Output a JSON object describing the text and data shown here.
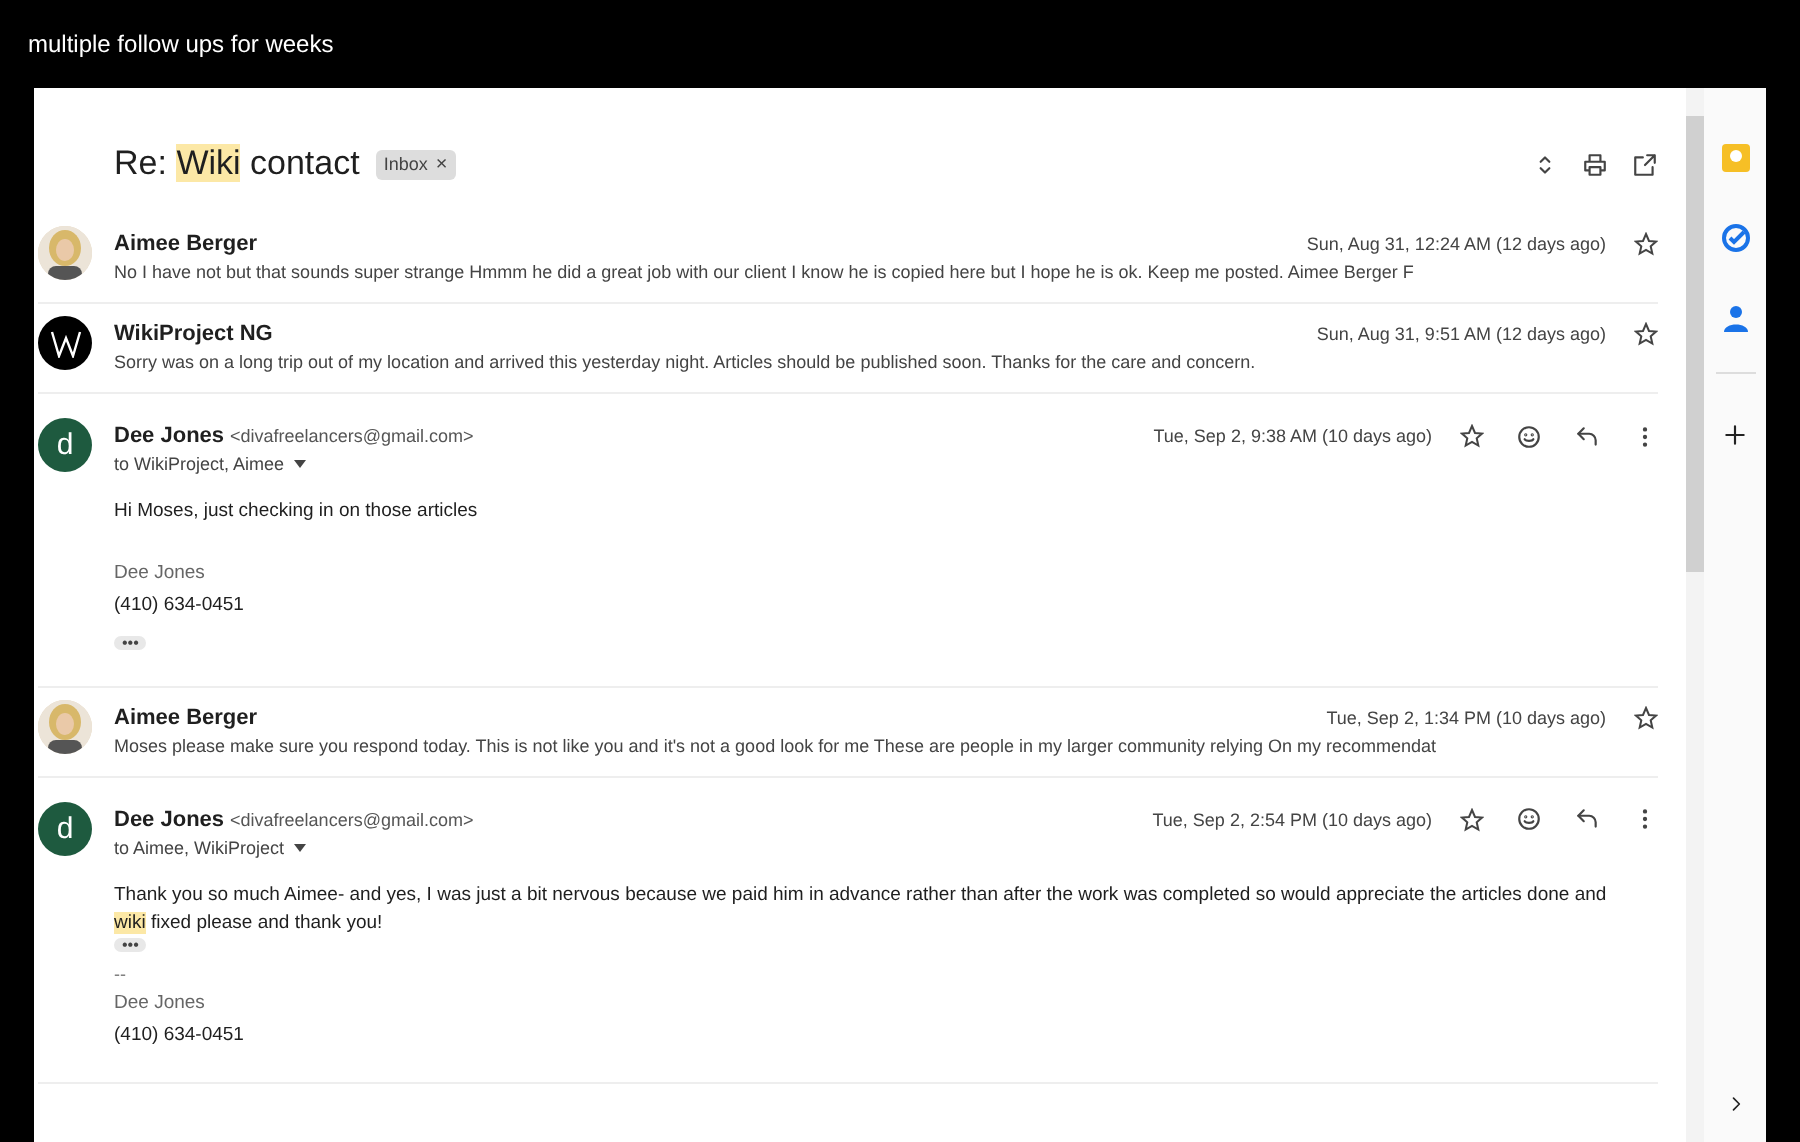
{
  "caption": "multiple follow ups for weeks",
  "subject": {
    "parts": [
      {
        "text": "Re: ",
        "highlight": false
      },
      {
        "text": "Wiki",
        "highlight": true
      },
      {
        "text": " contact",
        "highlight": false
      }
    ],
    "label": "Inbox",
    "label_close": "×"
  },
  "messages": [
    {
      "kind": "collapsed",
      "sender": "Aimee Berger",
      "date": "Sun, Aug 31, 12:24 AM (12 days ago)",
      "starred": false,
      "snippet": "No I have not but that sounds super strange Hmmm he did a great job with our client I know he is copied here but I hope he is ok. Keep me posted. Aimee Berger F"
    },
    {
      "kind": "collapsed",
      "avatar": {
        "kind": "logo"
      },
      "sender": "WikiProject NG",
      "date": "Sun, Aug 31, 9:51 AM (12 days ago)",
      "starred": false,
      "snippet": "Sorry was on a long trip out of my location and arrived this yesterday night. Articles should be published soon. Thanks for the care and concern."
    },
    {
      "kind": "expanded",
      "avatar": {
        "kind": "letter",
        "letter": "d"
      },
      "sender": "Dee Jones",
      "email": "<divafreelancers@gmail.com>",
      "to": "to WikiProject, Aimee",
      "date": "Tue, Sep 2, 9:38 AM (10 days ago)",
      "starred": false,
      "blocks": [
        {
          "kind": "text",
          "runs": [
            {
              "text": "Hi Moses, just checking in on those articles",
              "highlight": false
            }
          ]
        },
        {
          "kind": "signature_name",
          "text": "Dee Jones"
        },
        {
          "kind": "signature_phone",
          "text": "(410) 634-0451"
        },
        {
          "kind": "trimmed",
          "label": "•••"
        }
      ]
    },
    {
      "kind": "collapsed",
      "sender": "Aimee Berger",
      "date": "Tue, Sep 2, 1:34 PM (10 days ago)",
      "starred": false,
      "snippet": "Moses please make sure you respond today. This is not like you and it's not a good look for me These are people in my larger community relying On my recommendat"
    },
    {
      "kind": "expanded",
      "avatar": {
        "kind": "letter",
        "letter": "d"
      },
      "sender": "Dee Jones",
      "email": "<divafreelancers@gmail.com>",
      "to": "to Aimee, WikiProject",
      "date": "Tue, Sep 2, 2:54 PM (10 days ago)",
      "starred": false,
      "blocks": [
        {
          "kind": "text",
          "runs": [
            {
              "text": "Thank you so much Aimee- and yes, I was just a bit nervous because we paid him in advance rather than after the work was completed so would appreciate the articles done and ",
              "highlight": false
            },
            {
              "text": "wiki",
              "highlight": true
            },
            {
              "text": " fixed please and thank you!",
              "highlight": false
            }
          ]
        },
        {
          "kind": "trimmed",
          "label": "•••"
        },
        {
          "kind": "separator",
          "text": "--"
        },
        {
          "kind": "signature_name",
          "text": "Dee Jones"
        },
        {
          "kind": "signature_phone",
          "text": "(410) 634-0451"
        }
      ]
    }
  ]
}
